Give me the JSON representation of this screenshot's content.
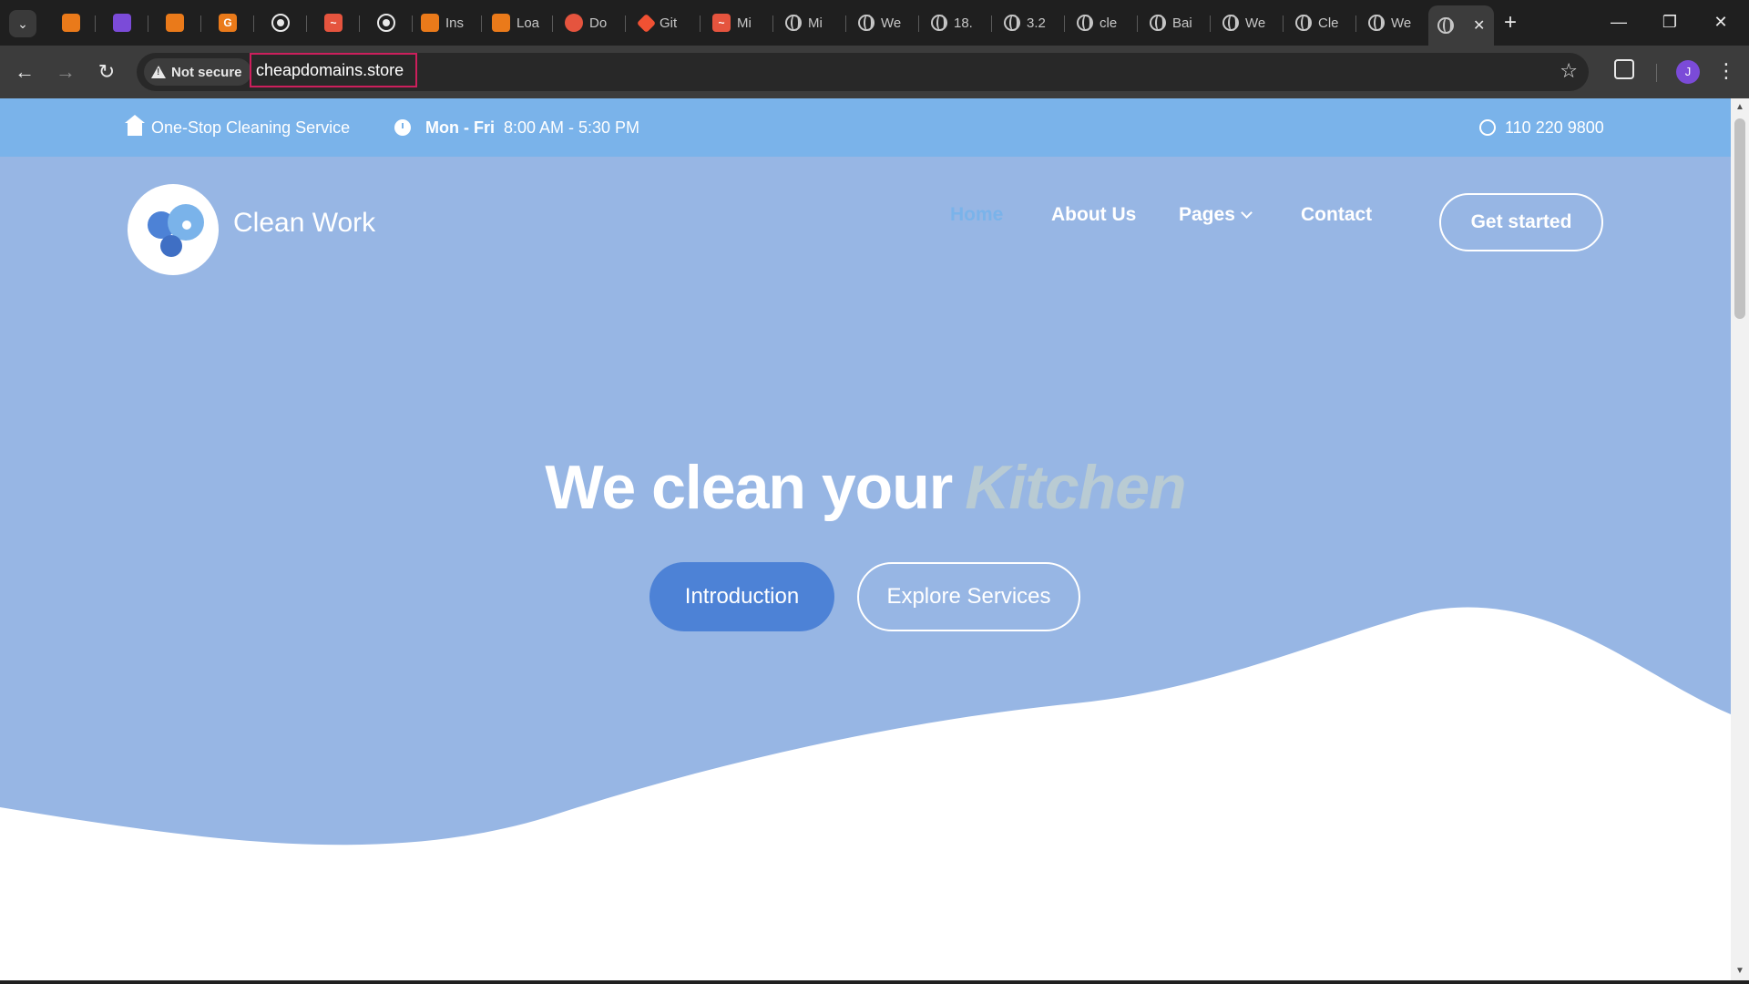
{
  "browser": {
    "tabs": [
      {
        "label": "",
        "favicon": "orange-square-icon"
      },
      {
        "label": "",
        "favicon": "purple-app-icon"
      },
      {
        "label": "",
        "favicon": "orange-square-icon"
      },
      {
        "label": "",
        "favicon": "orange-g-icon"
      },
      {
        "label": "",
        "favicon": "github-icon"
      },
      {
        "label": "",
        "favicon": "red-wave-icon"
      },
      {
        "label": "",
        "favicon": "github-icon"
      },
      {
        "label": "Ins",
        "favicon": "orange-square-icon"
      },
      {
        "label": "Loa",
        "favicon": "orange-square-icon"
      },
      {
        "label": "Do",
        "favicon": "red-circle-icon"
      },
      {
        "label": "Git",
        "favicon": "git-icon"
      },
      {
        "label": "Mi",
        "favicon": "red-wave-icon"
      },
      {
        "label": "Mi",
        "favicon": "globe-icon"
      },
      {
        "label": "We",
        "favicon": "globe-icon"
      },
      {
        "label": "18.",
        "favicon": "globe-icon"
      },
      {
        "label": "3.2",
        "favicon": "globe-icon"
      },
      {
        "label": "cle",
        "favicon": "globe-icon"
      },
      {
        "label": "Bai",
        "favicon": "globe-icon"
      },
      {
        "label": "We",
        "favicon": "globe-icon"
      },
      {
        "label": "Cle",
        "favicon": "globe-icon"
      },
      {
        "label": "We",
        "favicon": "globe-icon"
      }
    ],
    "new_tab_symbol": "+",
    "security_label": "Not secure",
    "url": "cheapdomains.store",
    "profile_initial": "J"
  },
  "site": {
    "topbar": {
      "service": "One-Stop Cleaning Service",
      "days": "Mon - Fri",
      "hours": "8:00 AM - 5:30 PM",
      "phone": "110 220 9800"
    },
    "brand": "Clean Work",
    "nav": {
      "home": "Home",
      "about": "About Us",
      "pages": "Pages",
      "contact": "Contact"
    },
    "cta": "Get started",
    "hero": {
      "headline": "We clean your",
      "headline_accent": "Kitchen",
      "primary_button": "Introduction",
      "secondary_button": "Explore Services"
    }
  },
  "colors": {
    "topbar_bg": "#7ab3ea",
    "hero_bg": "#97b6e4",
    "primary_button": "#4d82d6",
    "url_highlight": "#cc1f5c"
  }
}
